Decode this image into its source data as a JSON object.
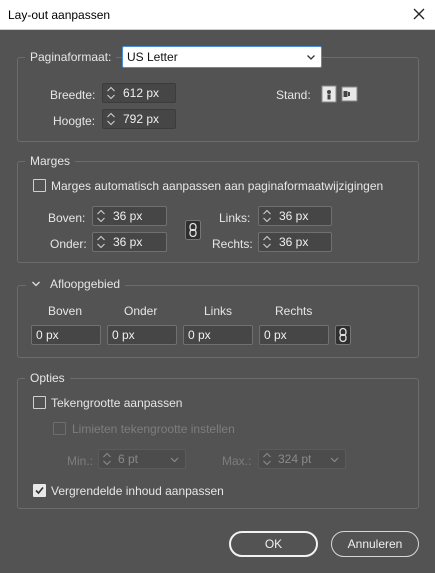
{
  "window": {
    "title": "Lay-out aanpassen"
  },
  "page_size": {
    "label": "Paginaformaat:",
    "selected": "US Letter",
    "width_label": "Breedte:",
    "width_value": "612 px",
    "height_label": "Hoogte:",
    "height_value": "792 px",
    "orientation_label": "Stand:"
  },
  "margins": {
    "legend": "Marges",
    "auto_adjust_label": "Marges automatisch aanpassen aan paginaformaatwijzigingen",
    "auto_adjust_checked": false,
    "top_label": "Boven:",
    "top_value": "36 px",
    "bottom_label": "Onder:",
    "bottom_value": "36 px",
    "left_label": "Links:",
    "left_value": "36 px",
    "right_label": "Rechts:",
    "right_value": "36 px"
  },
  "bleed": {
    "legend": "Afloopgebied",
    "columns": [
      "Boven",
      "Onder",
      "Links",
      "Rechts"
    ],
    "values": [
      "0 px",
      "0 px",
      "0 px",
      "0 px"
    ]
  },
  "options": {
    "legend": "Opties",
    "resize_text_label": "Tekengrootte aanpassen",
    "resize_text_checked": false,
    "limit_text_label": "Limieten tekengrootte instellen",
    "limit_text_checked": false,
    "min_label": "Min.:",
    "min_value": "6 pt",
    "max_label": "Max.:",
    "max_value": "324 pt",
    "locked_content_label": "Vergrendelde inhoud aanpassen",
    "locked_content_checked": true
  },
  "buttons": {
    "ok": "OK",
    "cancel": "Annuleren"
  },
  "colors": {
    "background": "#535353",
    "focus_border": "#4a90d9",
    "title_bar": "#ffffff"
  }
}
